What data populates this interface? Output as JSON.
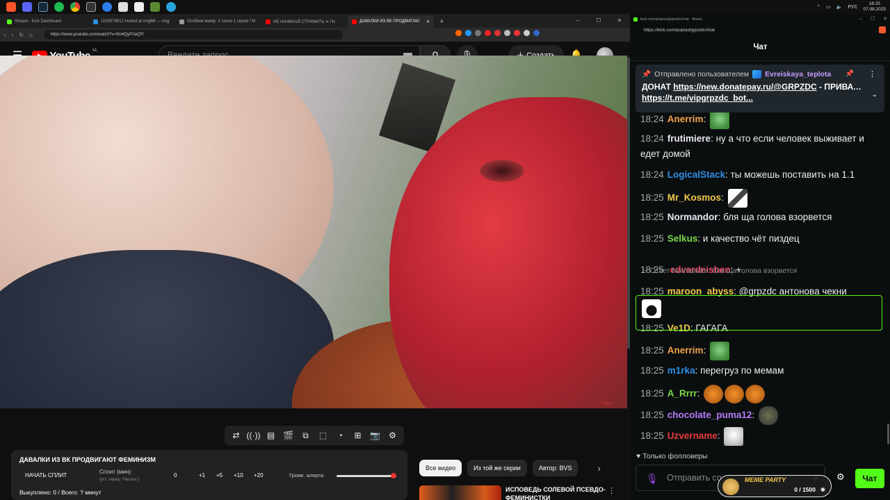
{
  "taskbar": {
    "time": "18:25",
    "date": "07.08.2025",
    "language": "РУС"
  },
  "browser": {
    "tabs": [
      {
        "title": "Stream - Kick Dashboard",
        "color": "#53fc18",
        "active": false
      },
      {
        "title": "1109379912 hosted at ImgBB — Img",
        "color": "#2b91e0",
        "active": false
      },
      {
        "title": "Особняк мияф -1 сезон 1 серия / M",
        "color": "#999999",
        "active": false
      },
      {
        "title": "НЕ НАЧИНАЙ СТРИМИТЬ ✕ Пс",
        "color": "#ff0000",
        "active": false
      },
      {
        "title": "ДАВАЛКИ ИЗ ВК ПРОДВИГАЮ",
        "color": "#ff0000",
        "active": true
      }
    ],
    "url": "https://www.youtube.com/watch?v=0m4QyP2aQfY"
  },
  "youtube": {
    "logo_text": "YouTube",
    "region": "NL",
    "search_placeholder": "Введите запрос",
    "create_label": "Создать"
  },
  "split_panel": {
    "title": "ДАВАЛКИ ИЗ ВК ПРОДВИГАЮТ ФЕМИНИЗМ",
    "start_label": "НАЧАТЬ СПЛИТ",
    "split_label": "Сплит (мин):",
    "split_sub": "(уст. перед \"Начать\")",
    "split_value": "0",
    "steps": [
      "+1",
      "+5",
      "+10",
      "+20"
    ],
    "alert_label": "Громк. алерта:",
    "alert_level": 1.0,
    "footer": "Выкуплено: 0 / Всего: ? минут"
  },
  "chips": [
    "Все видео",
    "Из той же серии",
    "Автор: BVS"
  ],
  "recommendation": {
    "title": "ИСПОВЕДЬ СОЛЕВОЙ ПСЕВДО-ФЕМИНИСТКИ"
  },
  "video": {
    "watermark": "~RG~"
  },
  "chat_window": {
    "title": "kick.com/popout/grpzdc/chat - Brave",
    "url": "https://kick.com/popout/grpzdc/chat",
    "header": "Чат",
    "pinned": {
      "prefix": "Отправлено пользователем",
      "user": "Evreiskaya_teplota",
      "text1": "ДОНАТ ",
      "link1": "https://new.donatepay.ru/@GRPZDC",
      "text2": " - ПРИВАТКА С ЧАТОМ - ",
      "link2": "https://t.me/vipgrpzdc_bot..."
    },
    "messages": [
      {
        "time": "18:24",
        "user": "Anerrim",
        "color": "#f2a34b",
        "text": "",
        "emotes": [
          "pepe"
        ]
      },
      {
        "time": "18:24",
        "user": "frutimiere",
        "color": "#e9e7f4",
        "text": "ну а что если человек выживает и едет домой",
        "emotes": []
      },
      {
        "time": "18:24",
        "user": "LogicalStack",
        "color": "#2f8fe6",
        "text": "ты можешь поставить на 1.1",
        "emotes": []
      },
      {
        "time": "18:25",
        "user": "Mr_Kosmos",
        "color": "#f2c94c",
        "text": "",
        "emotes": [
          "cat"
        ]
      },
      {
        "time": "18:25",
        "user": "Normandor",
        "color": "#e9e7f4",
        "text": "бля ща голова взорвется",
        "emotes": []
      },
      {
        "time": "18:25",
        "user": "Selkus",
        "color": "#7cd94b",
        "text": "и качество чёт пиздец",
        "emotes": []
      },
      {
        "time": "18:25",
        "user": "edvardeishen",
        "color": "#e8405a",
        "text": "+",
        "emotes": []
      },
      {
        "time": "18:25",
        "user": "maroon_abyss",
        "color": "#f2c94c",
        "text": "@grpzdc антонова чекни",
        "emotes": [
          "egg"
        ]
      },
      {
        "time": "18:25",
        "user": "Ve1D",
        "color": "#f2c94c",
        "text": "ГАГАГА",
        "emotes": []
      },
      {
        "time": "18:25",
        "user": "Anerrim",
        "color": "#f2a34b",
        "text": "",
        "emotes": [
          "pepe"
        ]
      },
      {
        "time": "18:25",
        "user": "m1rka",
        "color": "#2f8fe6",
        "text": "перегруз по мемам",
        "emotes": []
      },
      {
        "time": "18:25",
        "user": "A_Rrrr",
        "color": "#7cd94b",
        "text": "",
        "emotes": [
          "orange",
          "orange",
          "orange"
        ]
      },
      {
        "time": "18:25",
        "user": "chocolate_puma12",
        "color": "#b57bf7",
        "text": "",
        "emotes": [
          "dark"
        ]
      },
      {
        "time": "18:25",
        "user": "Uzvername",
        "color": "#e83b3b",
        "text": "",
        "emotes": [
          "dog"
        ]
      }
    ],
    "reply_note": "Ответ Normandor: бля ща голова взорвется",
    "followers_only": "Только фолловеры",
    "input_placeholder": "Отправить со...",
    "send_label": "Чат",
    "meme_party": {
      "title": "MEME PARTY",
      "count": "0 / 1500"
    }
  }
}
